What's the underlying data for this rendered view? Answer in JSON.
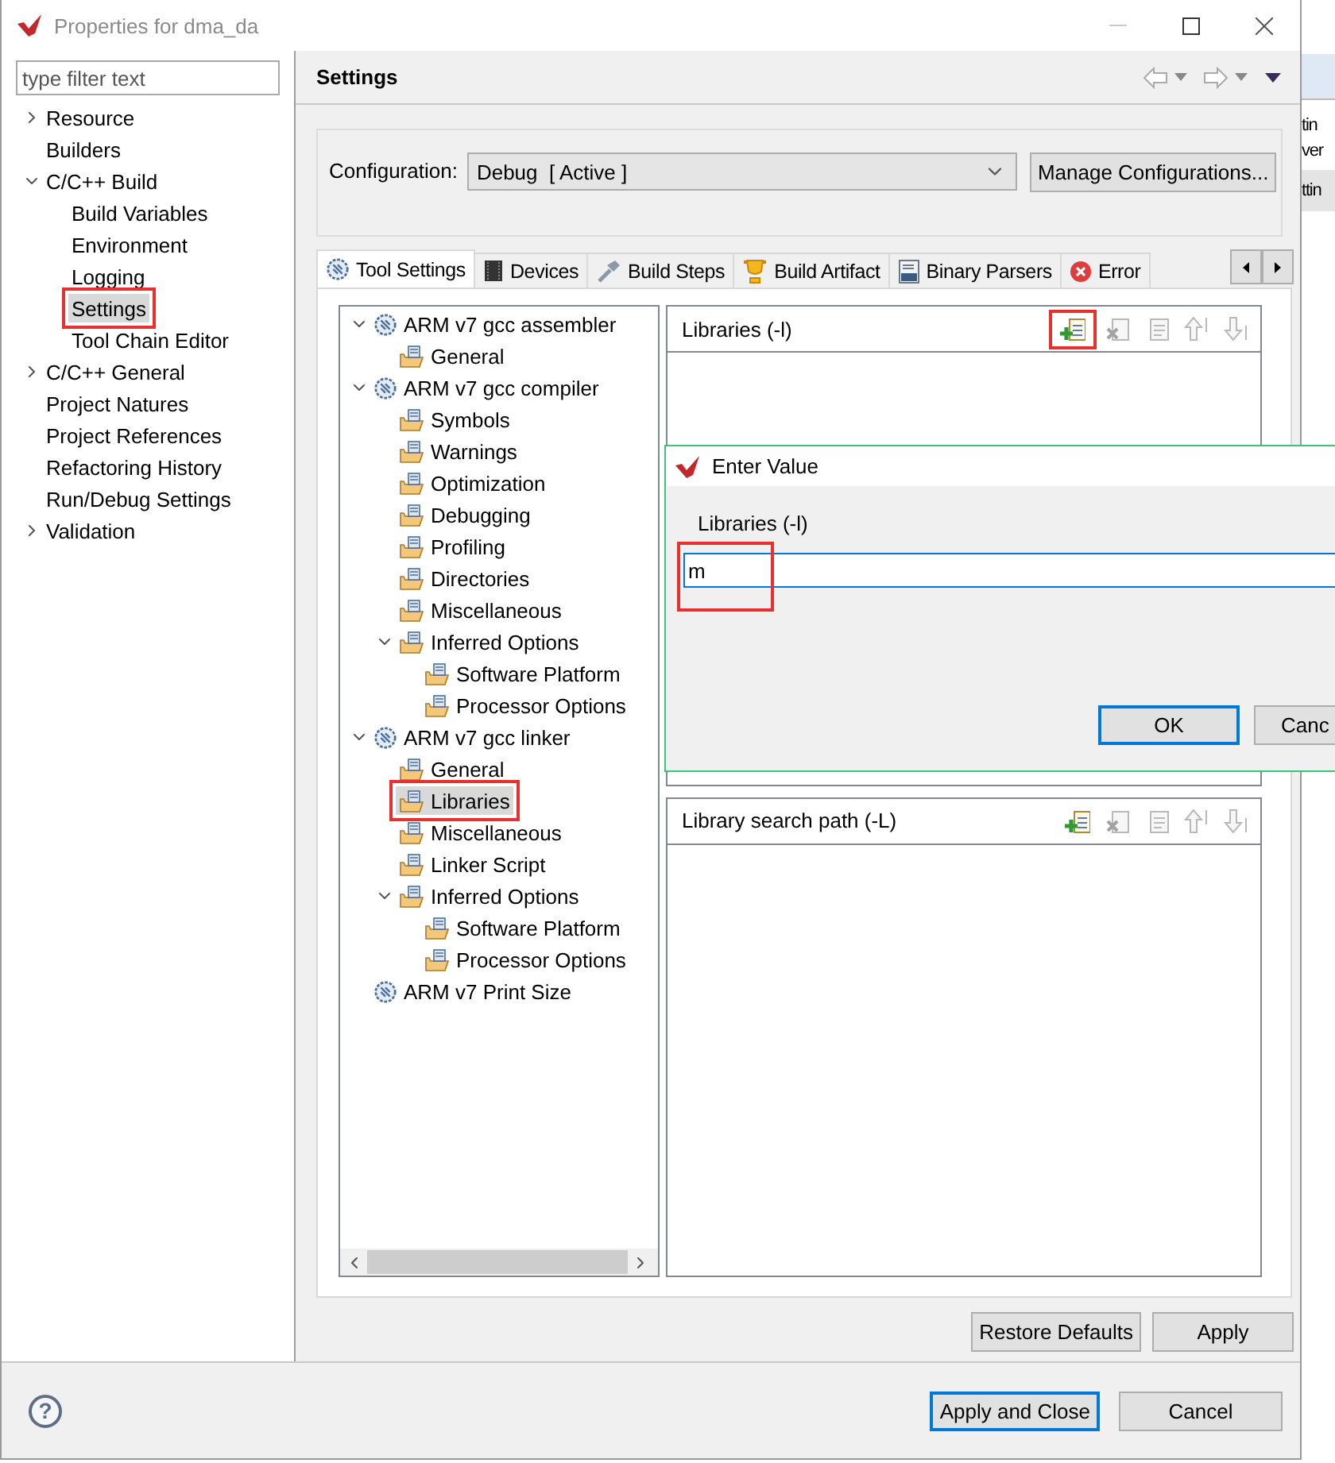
{
  "window": {
    "title": "Properties for dma_da"
  },
  "filter": {
    "placeholder": "type filter text"
  },
  "nav_tree": [
    {
      "label": "Resource",
      "expanded": false,
      "selected": false,
      "highlighted": false
    },
    {
      "label": "Builders",
      "selected": false,
      "highlighted": false
    },
    {
      "label": "C/C++ Build",
      "expanded": true,
      "selected": false,
      "highlighted": false,
      "children": [
        {
          "label": "Build Variables",
          "selected": false,
          "highlighted": false
        },
        {
          "label": "Environment",
          "selected": false,
          "highlighted": false
        },
        {
          "label": "Logging",
          "selected": false,
          "highlighted": false
        },
        {
          "label": "Settings",
          "selected": true,
          "highlighted": true
        },
        {
          "label": "Tool Chain Editor",
          "selected": false,
          "highlighted": false
        }
      ]
    },
    {
      "label": "C/C++ General",
      "expanded": false,
      "selected": false,
      "highlighted": false
    },
    {
      "label": "Project Natures",
      "selected": false,
      "highlighted": false
    },
    {
      "label": "Project References",
      "selected": false,
      "highlighted": false
    },
    {
      "label": "Refactoring History",
      "selected": false,
      "highlighted": false
    },
    {
      "label": "Run/Debug Settings",
      "selected": false,
      "highlighted": false
    },
    {
      "label": "Validation",
      "expanded": false,
      "selected": false,
      "highlighted": false
    }
  ],
  "header": {
    "title": "Settings"
  },
  "configuration": {
    "label": "Configuration:",
    "value": "Debug  [ Active ]",
    "button": "Manage Configurations..."
  },
  "tabs": [
    {
      "label": "Tool Settings",
      "selected": true
    },
    {
      "label": "Devices",
      "selected": false
    },
    {
      "label": "Build Steps",
      "selected": false
    },
    {
      "label": "Build Artifact",
      "selected": false
    },
    {
      "label": "Binary Parsers",
      "selected": false
    },
    {
      "label": "Error",
      "selected": false
    }
  ],
  "tool_tree": [
    {
      "label": "ARM v7 gcc assembler",
      "expanded": true,
      "selected": false,
      "highlighted": false,
      "children": [
        {
          "label": "General",
          "selected": false,
          "highlighted": false
        }
      ]
    },
    {
      "label": "ARM v7 gcc compiler",
      "expanded": true,
      "selected": false,
      "highlighted": false,
      "children": [
        {
          "label": "Symbols",
          "selected": false,
          "highlighted": false
        },
        {
          "label": "Warnings",
          "selected": false,
          "highlighted": false
        },
        {
          "label": "Optimization",
          "selected": false,
          "highlighted": false
        },
        {
          "label": "Debugging",
          "selected": false,
          "highlighted": false
        },
        {
          "label": "Profiling",
          "selected": false,
          "highlighted": false
        },
        {
          "label": "Directories",
          "selected": false,
          "highlighted": false
        },
        {
          "label": "Miscellaneous",
          "selected": false,
          "highlighted": false
        },
        {
          "label": "Inferred Options",
          "expanded": true,
          "selected": false,
          "highlighted": false,
          "children": [
            {
              "label": "Software Platform",
              "selected": false,
              "highlighted": false
            },
            {
              "label": "Processor Options",
              "selected": false,
              "highlighted": false
            }
          ]
        }
      ]
    },
    {
      "label": "ARM v7 gcc linker",
      "expanded": true,
      "selected": false,
      "highlighted": false,
      "children": [
        {
          "label": "General",
          "selected": false,
          "highlighted": false
        },
        {
          "label": "Libraries",
          "selected": true,
          "highlighted": true
        },
        {
          "label": "Miscellaneous",
          "selected": false,
          "highlighted": false
        },
        {
          "label": "Linker Script",
          "selected": false,
          "highlighted": false
        },
        {
          "label": "Inferred Options",
          "expanded": true,
          "selected": false,
          "highlighted": false,
          "children": [
            {
              "label": "Software Platform",
              "selected": false,
              "highlighted": false
            },
            {
              "label": "Processor Options",
              "selected": false,
              "highlighted": false
            }
          ]
        }
      ]
    },
    {
      "label": "ARM v7 Print Size",
      "selected": false,
      "highlighted": false
    }
  ],
  "panels": [
    {
      "title": "Libraries (-l)",
      "tools": [
        {
          "disabled": false,
          "highlighted": true
        },
        {
          "disabled": true,
          "highlighted": false
        },
        {
          "disabled": true,
          "highlighted": false
        },
        {
          "disabled": true,
          "highlighted": false
        },
        {
          "disabled": true,
          "highlighted": false
        }
      ]
    },
    {
      "title": "Library search path (-L)",
      "tools": [
        {
          "disabled": false,
          "highlighted": false
        },
        {
          "disabled": true,
          "highlighted": false
        },
        {
          "disabled": true,
          "highlighted": false
        },
        {
          "disabled": true,
          "highlighted": false
        },
        {
          "disabled": true,
          "highlighted": false
        }
      ]
    }
  ],
  "page_buttons": [
    {
      "label": "Restore Defaults",
      "focused": false
    },
    {
      "label": "Apply",
      "focused": false
    }
  ],
  "footer": {
    "help": "?",
    "buttons": [
      {
        "label": "Apply and Close",
        "focused": true
      },
      {
        "label": "Cancel",
        "focused": false
      }
    ]
  },
  "dialog": {
    "title": "Enter Value",
    "label": "Libraries (-l)",
    "value": "m",
    "highlighted": true,
    "buttons": [
      {
        "label": "OK",
        "focused": true
      },
      {
        "label": "Canc",
        "focused": false
      }
    ]
  },
  "background_window": {
    "texts": [
      "tin",
      "ver",
      "ttin"
    ]
  }
}
